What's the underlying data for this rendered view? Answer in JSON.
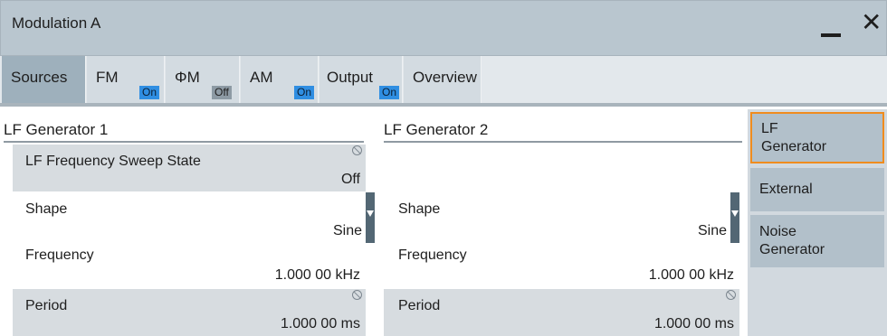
{
  "window": {
    "title": "Modulation A"
  },
  "tabs": [
    {
      "label": "Sources",
      "badge": ""
    },
    {
      "label": "FM",
      "badge": "On"
    },
    {
      "label": "ΦM",
      "badge": "Off"
    },
    {
      "label": "AM",
      "badge": "On"
    },
    {
      "label": "Output",
      "badge": "On"
    },
    {
      "label": "Overview",
      "badge": ""
    }
  ],
  "lf_generator_1": {
    "heading": "LF Generator 1",
    "sweep_state": {
      "label": "LF Frequency Sweep State",
      "value": "Off"
    },
    "shape": {
      "label": "Shape",
      "value": "Sine"
    },
    "frequency": {
      "label": "Frequency",
      "value": "1.000 00 kHz"
    },
    "period": {
      "label": "Period",
      "value": "1.000 00 ms"
    }
  },
  "lf_generator_2": {
    "heading": "LF Generator 2",
    "shape": {
      "label": "Shape",
      "value": "Sine"
    },
    "frequency": {
      "label": "Frequency",
      "value": "1.000 00 kHz"
    },
    "period": {
      "label": "Period",
      "value": "1.000 00 ms"
    }
  },
  "side_panel": {
    "items": [
      {
        "line1": "LF",
        "line2": "Generator"
      },
      {
        "line1": "External",
        "line2": ""
      },
      {
        "line1": "Noise",
        "line2": "Generator"
      }
    ]
  },
  "colors": {
    "badge_on": "#2f8ee2",
    "badge_off": "#8d9aa4",
    "active_outline": "#f08c1e",
    "title_bar": "#b9c6cf"
  },
  "icons": [
    "minimize-icon",
    "close-icon",
    "not-editable-icon",
    "dropdown-arrow-icon"
  ]
}
